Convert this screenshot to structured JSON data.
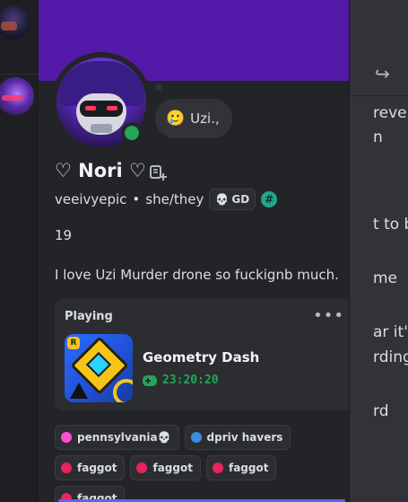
{
  "background": {
    "fragments": [
      "revei",
      "n",
      "t to b",
      "me",
      "ar it'",
      "rding",
      "rd"
    ]
  },
  "profile": {
    "display_name": "♡ Nori ♡",
    "username": "veeivyepic",
    "separator": "•",
    "pronouns": "she/they",
    "clan_tag": "GD",
    "clan_emoji": "💀",
    "hash_badge": "#",
    "status": "online",
    "custom_status_emoji": "🥲",
    "custom_status_text": "Uzi.,",
    "bio_lines": [
      "19",
      "I love Uzi Murder drone so fuckignb much."
    ],
    "colors": {
      "banner": "#5419a9",
      "online": "#23a55a"
    }
  },
  "activity": {
    "heading": "Playing",
    "more": "•••",
    "game_title": "Geometry Dash",
    "elapsed": "23:20:20"
  },
  "roles": [
    {
      "label": "pennsylvania💀",
      "color": "#ff4fd0"
    },
    {
      "label": "dpriv havers",
      "color": "#3b8fe0"
    },
    {
      "label": "faggot",
      "color": "#e8245e"
    },
    {
      "label": "faggot",
      "color": "#e8245e"
    },
    {
      "label": "faggot",
      "color": "#e8245e"
    },
    {
      "label": "faggot",
      "color": "#e8245e"
    }
  ]
}
